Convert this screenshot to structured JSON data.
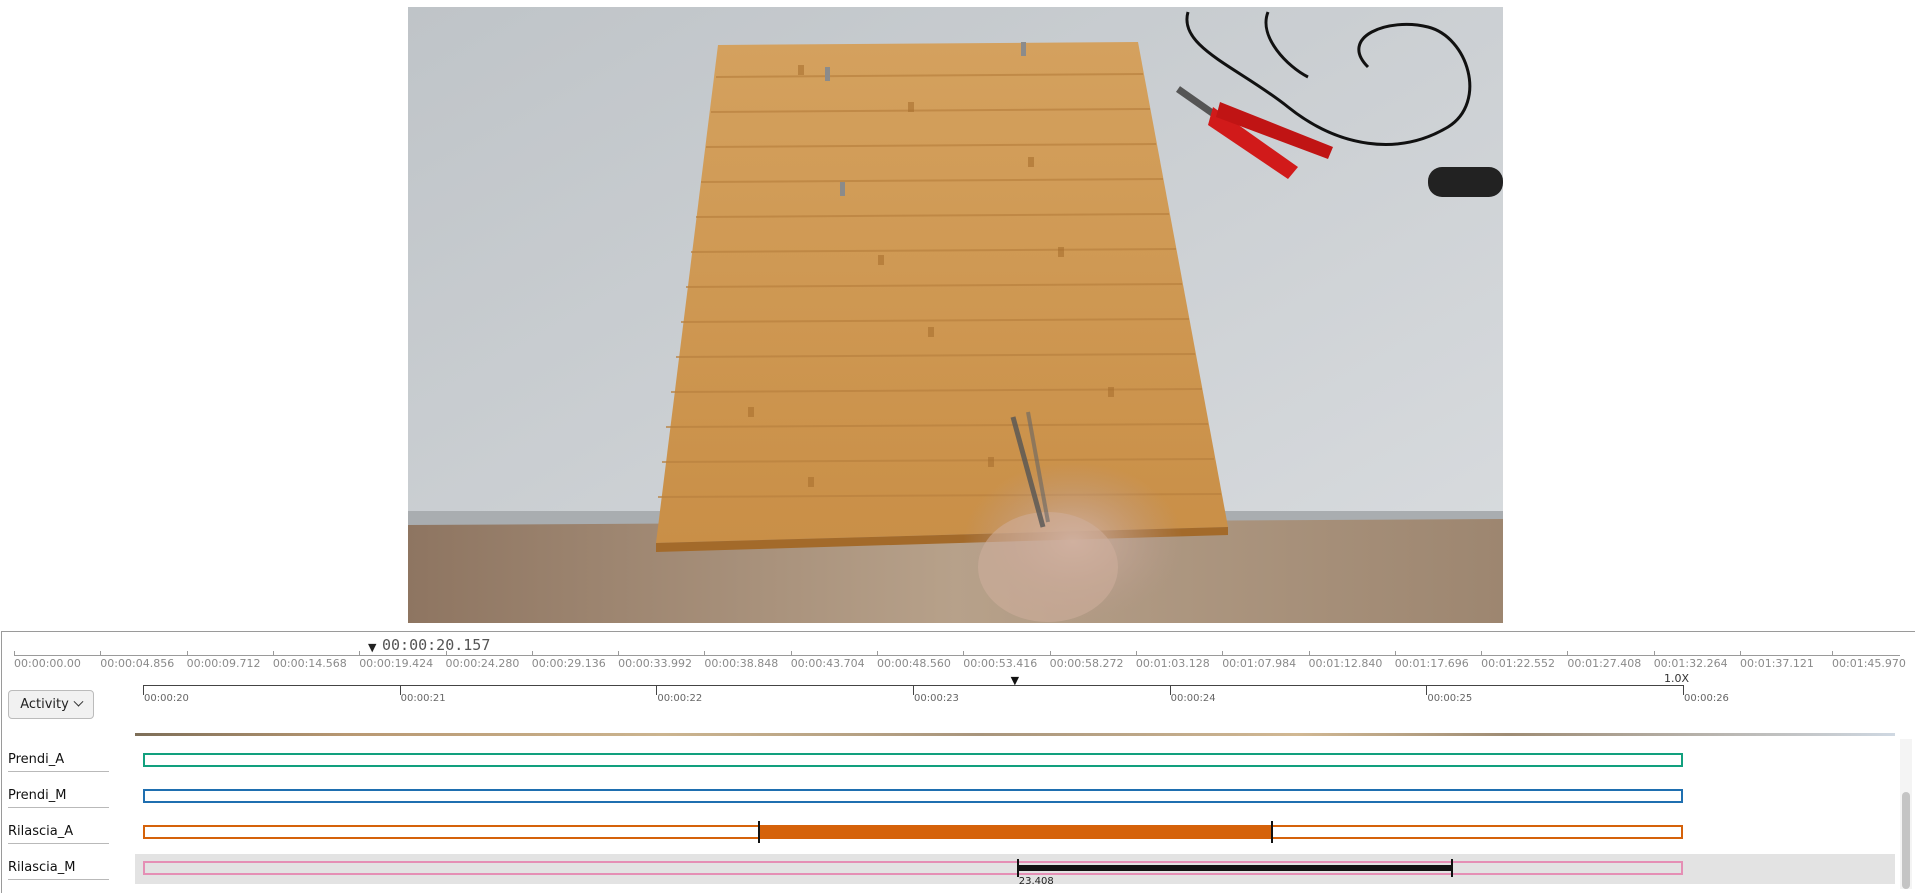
{
  "player": {
    "current_time": "00:00:20.157",
    "speed": "1.0X"
  },
  "overview_ticks": [
    "00:00:00.00",
    "00:00:04.856",
    "00:00:09.712",
    "00:00:14.568",
    "00:00:19.424",
    "00:00:24.280",
    "00:00:29.136",
    "00:00:33.992",
    "00:00:38.848",
    "00:00:43.704",
    "00:00:48.560",
    "00:00:53.416",
    "00:00:58.272",
    "00:01:03.128",
    "00:01:07.984",
    "00:01:12.840",
    "00:01:17.696",
    "00:01:22.552",
    "00:01:27.408",
    "00:01:32.264",
    "00:01:37.121",
    "00:01:45.970"
  ],
  "zoom_ticks": [
    "00:00:20",
    "00:00:21",
    "00:00:22",
    "00:00:23",
    "00:00:24",
    "00:00:25",
    "00:00:26"
  ],
  "zoom_range_seconds": [
    20,
    26
  ],
  "zoom_cursor_seconds": 23.4,
  "activity_button": {
    "label": "Activity"
  },
  "tracks": [
    {
      "label": "Prendi_A",
      "color": "#12a07e"
    },
    {
      "label": "Prendi_M",
      "color": "#1f6fb0"
    },
    {
      "label": "Rilascia_A",
      "color": "#d5620a",
      "segment_seconds": [
        22.4,
        24.4
      ]
    },
    {
      "label": "Rilascia_M",
      "color": "#e58fb5",
      "selected": true,
      "range_seconds": [
        23.408,
        25.1
      ],
      "range_label": "23.408"
    }
  ]
}
